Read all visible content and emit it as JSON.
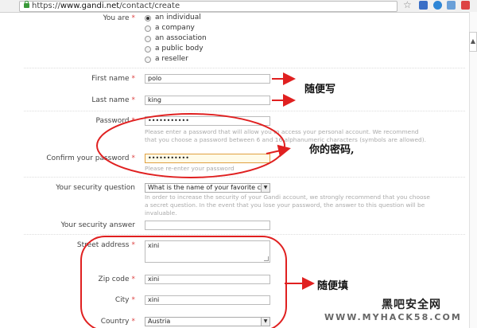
{
  "browser": {
    "url_scheme": "https://",
    "url_host": "www.gandi.net",
    "url_path": "/contact/create",
    "star_icon": "star-icon"
  },
  "form": {
    "you_are": {
      "label": "You are",
      "options": [
        "an individual",
        "a company",
        "an association",
        "a public body",
        "a reseller"
      ],
      "selected_index": 0
    },
    "first_name": {
      "label": "First name",
      "value": "polo"
    },
    "last_name": {
      "label": "Last name",
      "value": "king"
    },
    "password": {
      "label": "Password",
      "value": "•••••••••••",
      "help": "Please enter a password that will allow you to access your personal account. We recommend that you choose a password between 6 and 16 alphanumeric characters (symbols are allowed)."
    },
    "confirm_password": {
      "label": "Confirm your password",
      "value": "•••••••••••",
      "help": "Please re-enter your password"
    },
    "security_question": {
      "label": "Your security question",
      "value": "What is the name of your favorite city",
      "help": "In order to increase the security of your Gandi account, we strongly recommend that you choose a secret question. In the event that you lose your password, the answer to this question will be invaluable."
    },
    "security_answer": {
      "label": "Your security answer",
      "value": ""
    },
    "street_address": {
      "label": "Street address",
      "value": "xini"
    },
    "zip_code": {
      "label": "Zip code",
      "value": "xini"
    },
    "city": {
      "label": "City",
      "value": "xini"
    },
    "country": {
      "label": "Country",
      "value": "Austria"
    },
    "required_mark": "*"
  },
  "annotations": {
    "name_note": "随便写",
    "password_note": "你的密码,",
    "address_note": "随便填",
    "color": "#e02020"
  },
  "watermark": {
    "brand": "黑吧安全网",
    "url": "WWW.MYHACK58.COM"
  }
}
